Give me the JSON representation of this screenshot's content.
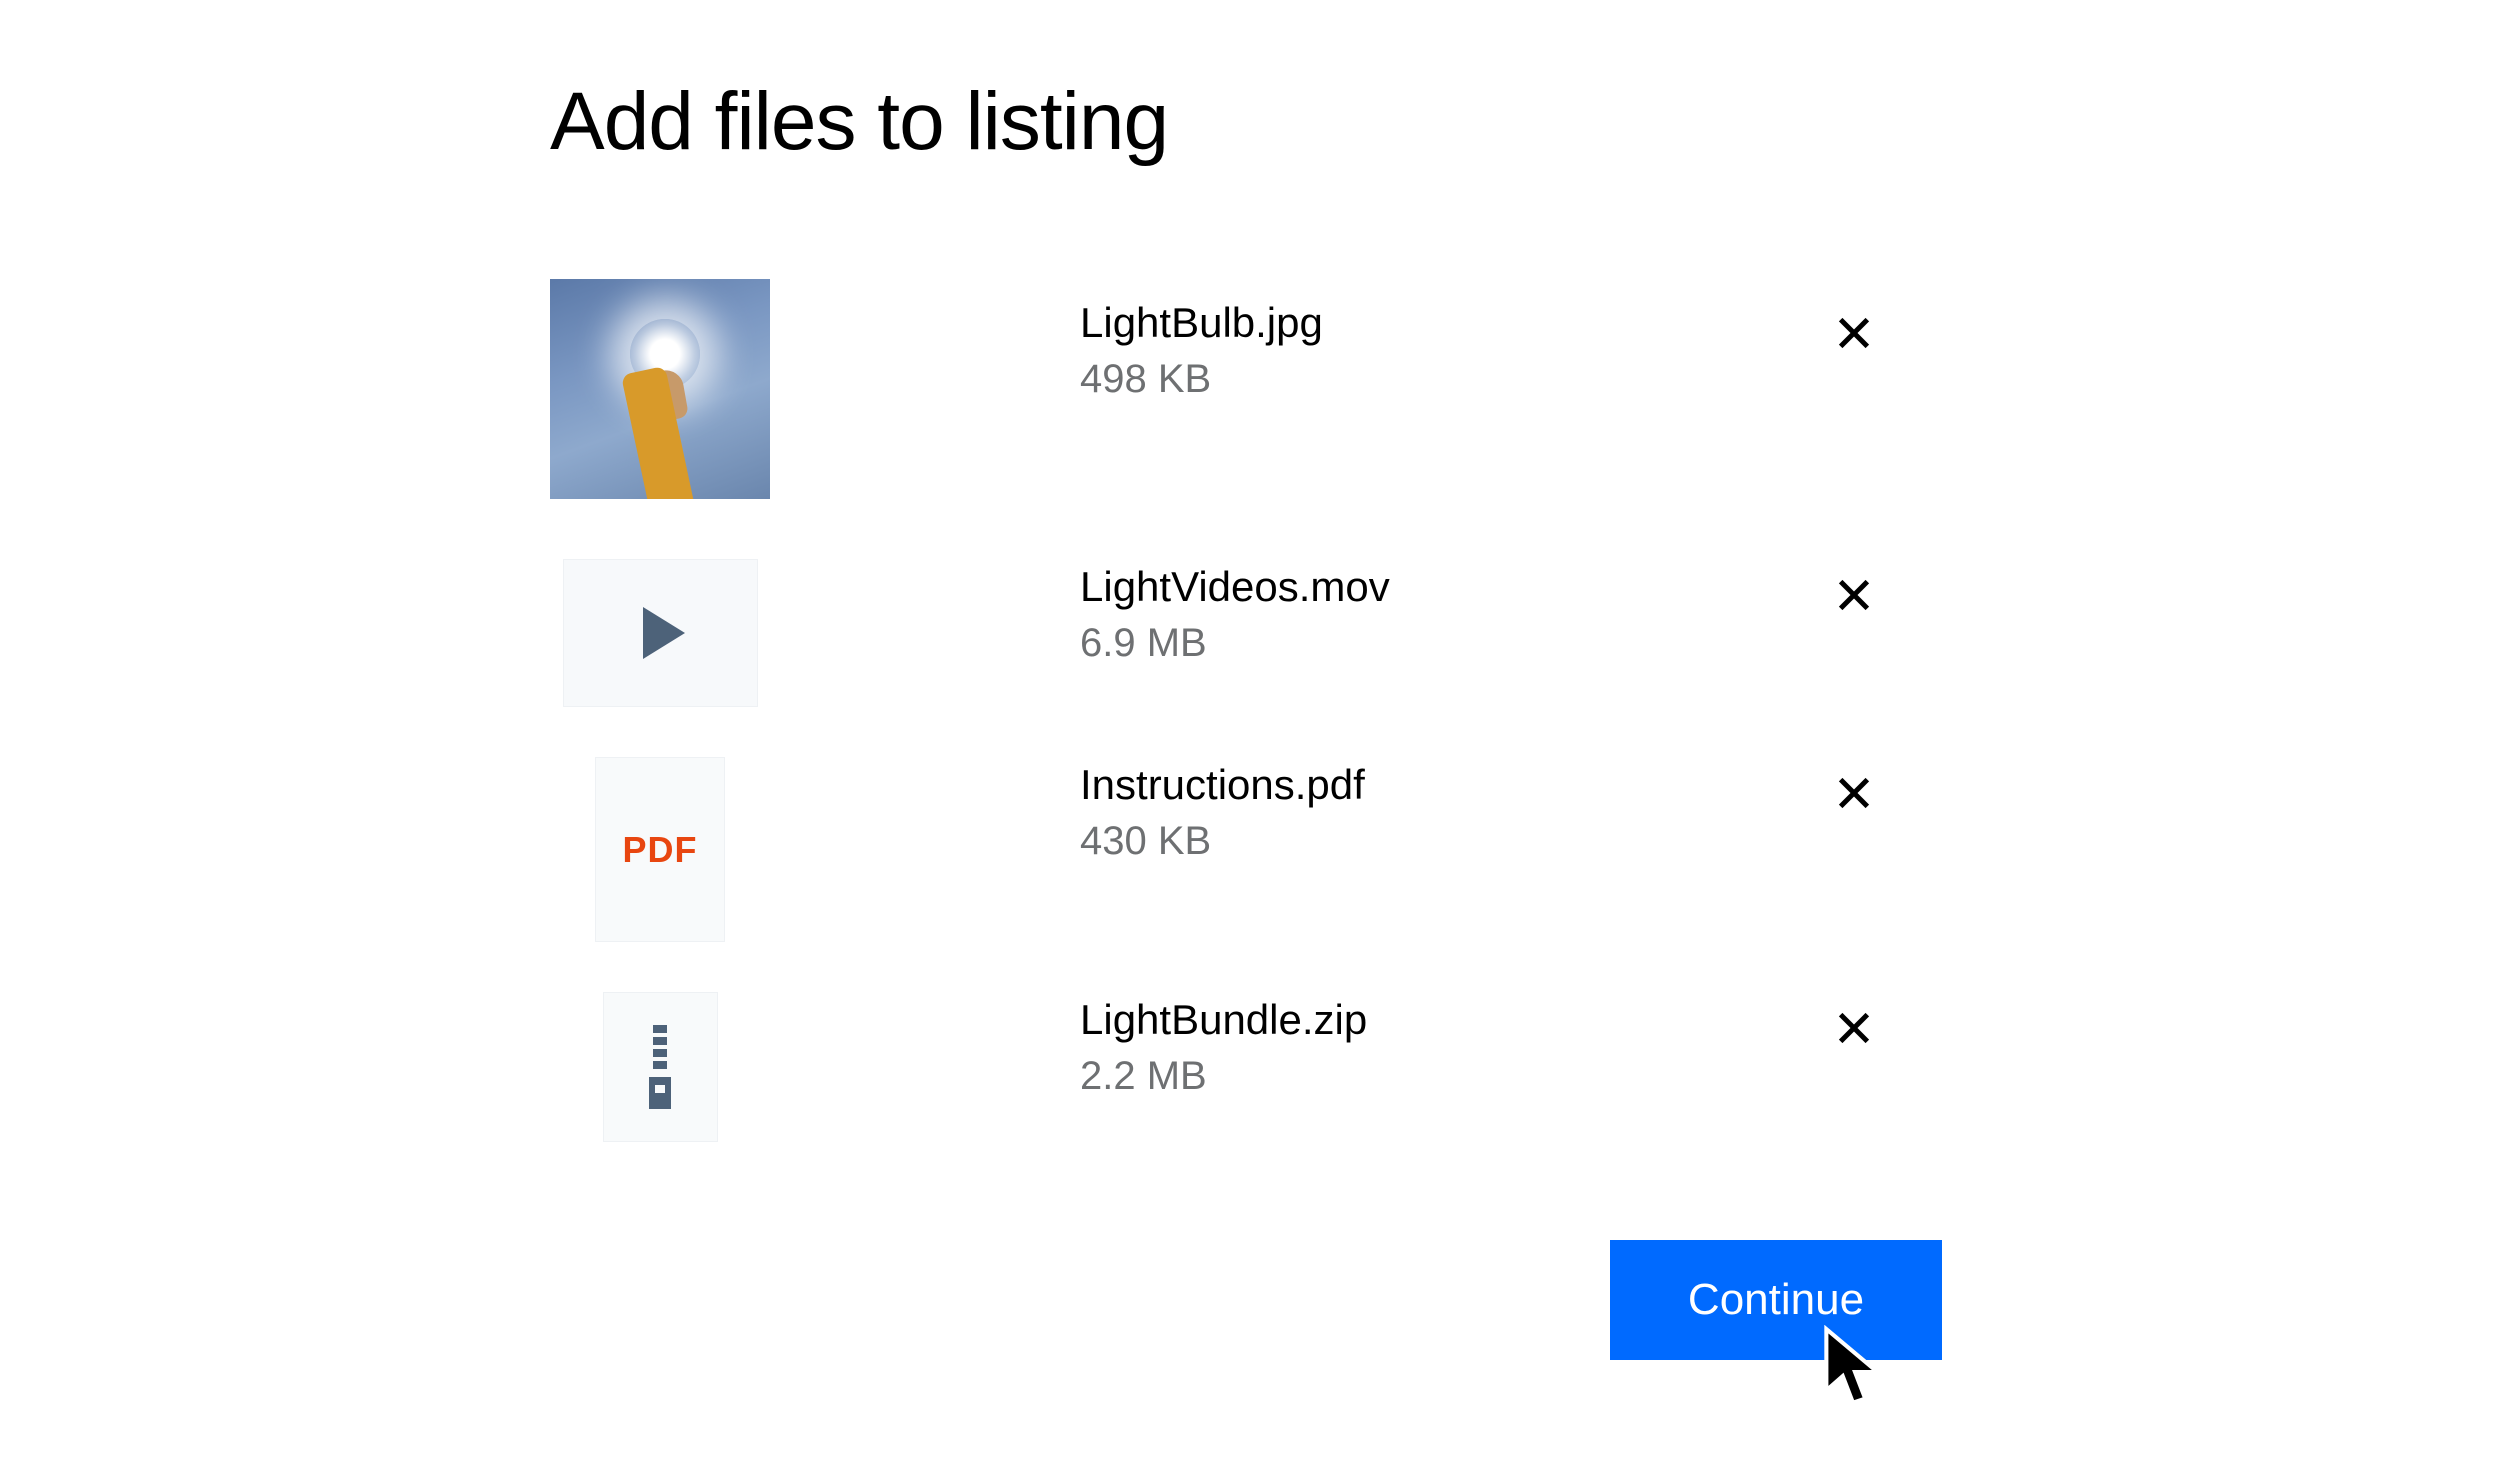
{
  "title": "Add files to listing",
  "files": [
    {
      "name": "LightBulb.jpg",
      "size": "498 KB",
      "thumb": "image"
    },
    {
      "name": "LightVideos.mov",
      "size": "6.9 MB",
      "thumb": "video"
    },
    {
      "name": "Instructions.pdf",
      "size": "430 KB",
      "thumb": "pdf"
    },
    {
      "name": "LightBundle.zip",
      "size": "2.2 MB",
      "thumb": "zip"
    }
  ],
  "pdf_label": "PDF",
  "continue_label": "Continue"
}
